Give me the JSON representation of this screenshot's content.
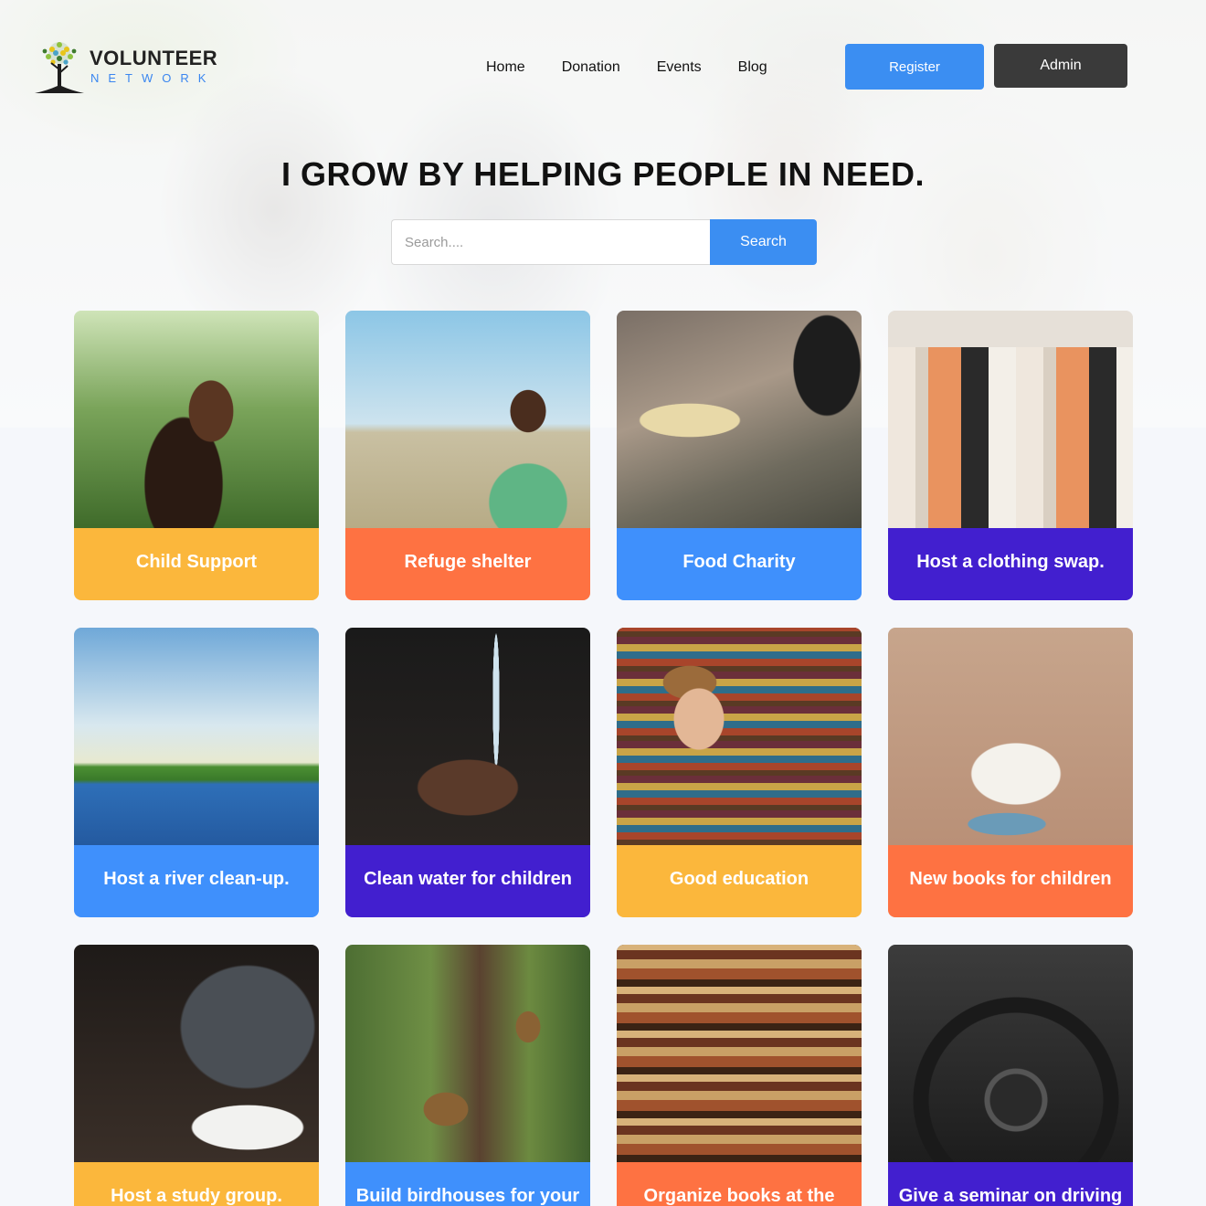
{
  "brand": {
    "name": "VOLUNTEER",
    "sub": "NETWORK",
    "colors": {
      "primary": "#3b8ef2",
      "dark": "#3a3a3a",
      "logo_green": "#3e7b2e",
      "logo_yellow": "#e8c51a"
    }
  },
  "nav": {
    "items": [
      {
        "label": "Home"
      },
      {
        "label": "Donation"
      },
      {
        "label": "Events"
      },
      {
        "label": "Blog"
      }
    ],
    "register_label": "Register",
    "admin_label": "Admin"
  },
  "hero": {
    "headline": "I GROW BY HELPING PEOPLE IN NEED.",
    "search": {
      "placeholder": "Search....",
      "button_label": "Search"
    }
  },
  "cards": [
    {
      "label": "Child Support",
      "color": "#fbb73c",
      "image": "girl-in-park"
    },
    {
      "label": "Refuge shelter",
      "color": "#fe7242",
      "image": "boy-in-field"
    },
    {
      "label": "Food Charity",
      "color": "#3f90fc",
      "image": "food-donation"
    },
    {
      "label": "Host a clothing swap.",
      "color": "#421fcf",
      "image": "clothing-rack"
    },
    {
      "label": "Host a river clean-up.",
      "color": "#3f90fc",
      "image": "river"
    },
    {
      "label": "Clean water for children",
      "color": "#421fcf",
      "image": "water-hands"
    },
    {
      "label": "Good education",
      "color": "#fbb73c",
      "image": "boy-reading"
    },
    {
      "label": "New books for children",
      "color": "#fe7242",
      "image": "open-book"
    },
    {
      "label": "Host a study group.",
      "color": "#fbb73c",
      "image": "study-group"
    },
    {
      "label": "Build birdhouses for your neighbors",
      "color": "#3f90fc",
      "image": "birdhouses"
    },
    {
      "label": "Organize books at the library",
      "color": "#fe7242",
      "image": "library-shelves"
    },
    {
      "label": "Give a seminar on driving safety",
      "color": "#421fcf",
      "image": "steering-wheel"
    }
  ]
}
